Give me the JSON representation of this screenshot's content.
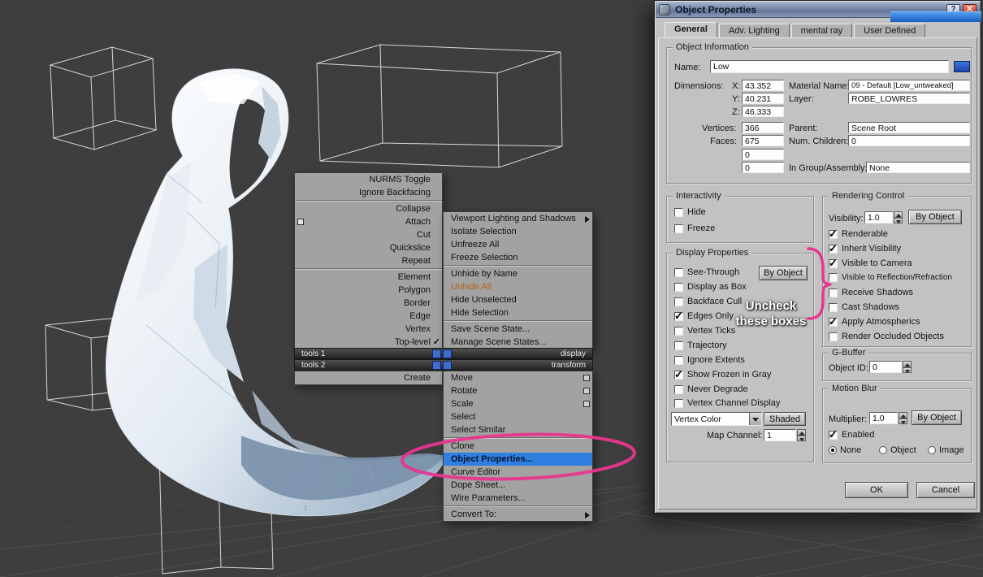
{
  "colors": {
    "menu_highlight": "#2f7fe0",
    "annotation_pink": "#e8368f",
    "name_swatch": "#2b5fc4"
  },
  "viewport": {
    "axis_label": "z"
  },
  "annotation": {
    "line1": "Uncheck",
    "line2": "these boxes"
  },
  "quad_menu": {
    "left": {
      "items": [
        {
          "label": "NURMS Toggle"
        },
        {
          "label": "Ignore Backfacing"
        },
        {
          "label": "Collapse"
        },
        {
          "label": "Attach"
        },
        {
          "label": "Cut"
        },
        {
          "label": "Quickslice"
        },
        {
          "label": "Repeat"
        },
        {
          "label": "Element"
        },
        {
          "label": "Polygon"
        },
        {
          "label": "Border"
        },
        {
          "label": "Edge"
        },
        {
          "label": "Vertex"
        },
        {
          "label": "Top-level",
          "checked": true
        }
      ],
      "create_label": "Create"
    },
    "headers": [
      {
        "left": "tools 1",
        "right": "display"
      },
      {
        "left": "tools 2",
        "right": "transform"
      }
    ],
    "right": {
      "upper_items": [
        {
          "label": "Viewport Lighting and Shadows",
          "submenu": true
        },
        {
          "label": "Isolate Selection"
        },
        {
          "label": "Unfreeze All"
        },
        {
          "label": "Freeze Selection"
        },
        {
          "label": "Unhide by Name"
        },
        {
          "label": "Unhide All",
          "accent": true
        },
        {
          "label": "Hide Unselected"
        },
        {
          "label": "Hide Selection"
        },
        {
          "label": "Save Scene State..."
        },
        {
          "label": "Manage Scene States..."
        }
      ],
      "lower_items": [
        {
          "label": "Move",
          "settings_box": true
        },
        {
          "label": "Rotate",
          "settings_box": true
        },
        {
          "label": "Scale",
          "settings_box": true
        },
        {
          "label": "Select"
        },
        {
          "label": "Select Similar"
        },
        {
          "label": "Clone"
        },
        {
          "label": "Object Properties...",
          "highlighted": true
        },
        {
          "label": "Curve Editor"
        },
        {
          "label": "Dope Sheet..."
        },
        {
          "label": "Wire Parameters..."
        },
        {
          "label": "Convert To:",
          "submenu": true
        }
      ]
    }
  },
  "dialog": {
    "window": {
      "title": "Object Properties",
      "help": "?",
      "close": "✕"
    },
    "tabs": [
      "General",
      "Adv. Lighting",
      "mental ray",
      "User Defined"
    ],
    "active_tab": "General",
    "object_information": {
      "title": "Object Information",
      "name_label": "Name:",
      "name_value": "Low",
      "dimensions_label": "Dimensions:",
      "x_label": "X:",
      "x_value": "43.352",
      "y_label": "Y:",
      "y_value": "40.231",
      "z_label": "Z:",
      "z_value": "46.333",
      "material_label": "Material Name:",
      "material_value": "09 - Default [Low_untweaked]",
      "layer_label": "Layer:",
      "layer_value": "ROBE_LOWRES",
      "vertices_label": "Vertices:",
      "vertices_value": "366",
      "parent_label": "Parent:",
      "parent_value": "Scene Root",
      "faces_label": "Faces:",
      "faces_value": "675",
      "children_label": "Num. Children:",
      "children_value": "0",
      "extra_value1": "0",
      "extra_value2": "0",
      "group_label": "In Group/Assembly:",
      "group_value": "None"
    },
    "interactivity": {
      "title": "Interactivity",
      "hide": {
        "label": "Hide",
        "checked": false
      },
      "freeze": {
        "label": "Freeze",
        "checked": false
      }
    },
    "display_properties": {
      "title": "Display Properties",
      "by_object": "By Object",
      "items": [
        {
          "label": "See-Through",
          "checked": false
        },
        {
          "label": "Display as Box",
          "checked": false
        },
        {
          "label": "Backface Cull",
          "checked": false
        },
        {
          "label": "Edges Only",
          "checked": true
        },
        {
          "label": "Vertex Ticks",
          "checked": false
        },
        {
          "label": "Trajectory",
          "checked": false
        },
        {
          "label": "Ignore Extents",
          "checked": false
        },
        {
          "label": "Show Frozen in Gray",
          "checked": true
        },
        {
          "label": "Never Degrade",
          "checked": false
        },
        {
          "label": "Vertex Channel Display",
          "checked": false
        }
      ],
      "vertex_color_select": "Vertex Color",
      "shaded_button": "Shaded",
      "map_channel_label": "Map Channel:",
      "map_channel_value": "1"
    },
    "rendering_control": {
      "title": "Rendering Control",
      "visibility_label": "Visibility:",
      "visibility_value": "1.0",
      "by_object": "By Object",
      "items": [
        {
          "label": "Renderable",
          "checked": true
        },
        {
          "label": "Inherit Visibility",
          "checked": true
        },
        {
          "label": "Visible to Camera",
          "checked": true
        },
        {
          "label": "Visible to Reflection/Refraction",
          "checked": false
        },
        {
          "label": "Receive Shadows",
          "checked": false
        },
        {
          "label": "Cast Shadows",
          "checked": false
        },
        {
          "label": "Apply Atmospherics",
          "checked": true
        },
        {
          "label": "Render Occluded Objects",
          "checked": false
        }
      ]
    },
    "g_buffer": {
      "title": "G-Buffer",
      "object_id_label": "Object ID:",
      "object_id_value": "0"
    },
    "motion_blur": {
      "title": "Motion Blur",
      "multiplier_label": "Multiplier:",
      "multiplier_value": "1.0",
      "by_object": "By Object",
      "enabled": {
        "label": "Enabled",
        "checked": true
      },
      "options": [
        {
          "label": "None",
          "selected": true
        },
        {
          "label": "Object",
          "selected": false
        },
        {
          "label": "Image",
          "selected": false
        }
      ]
    },
    "buttons": {
      "ok": "OK",
      "cancel": "Cancel"
    }
  }
}
